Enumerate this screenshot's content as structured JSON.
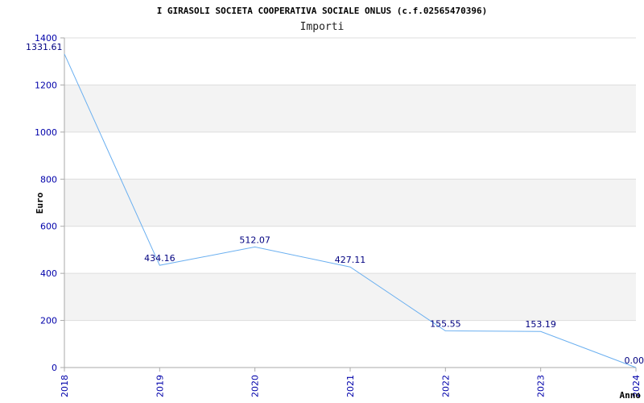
{
  "chart_data": {
    "type": "line",
    "title": "I GIRASOLI SOCIETA COOPERATIVA SOCIALE ONLUS (c.f.02565470396)",
    "subtitle": "Importi",
    "xlabel": "Anno",
    "ylabel": "Euro",
    "ylim": [
      0,
      1400
    ],
    "yticks": [
      0,
      200,
      400,
      600,
      800,
      1000,
      1200,
      1400
    ],
    "grid": true,
    "categories": [
      "2018",
      "2019",
      "2020",
      "2021",
      "2022",
      "2023",
      "2024"
    ],
    "series": [
      {
        "values": [
          1331.61,
          434.16,
          512.07,
          427.11,
          155.55,
          153.19,
          0.0
        ],
        "labels": [
          "1331.61",
          "434.16",
          "512.07",
          "427.11",
          "155.55",
          "153.19",
          "0.00"
        ]
      }
    ]
  },
  "colors": {
    "line": "#6aaff0",
    "band": "#f3f3f3",
    "grid": "#dddddd",
    "axis": "#aaaaaa",
    "tick_text": "#0000aa",
    "data_label": "#000080"
  }
}
